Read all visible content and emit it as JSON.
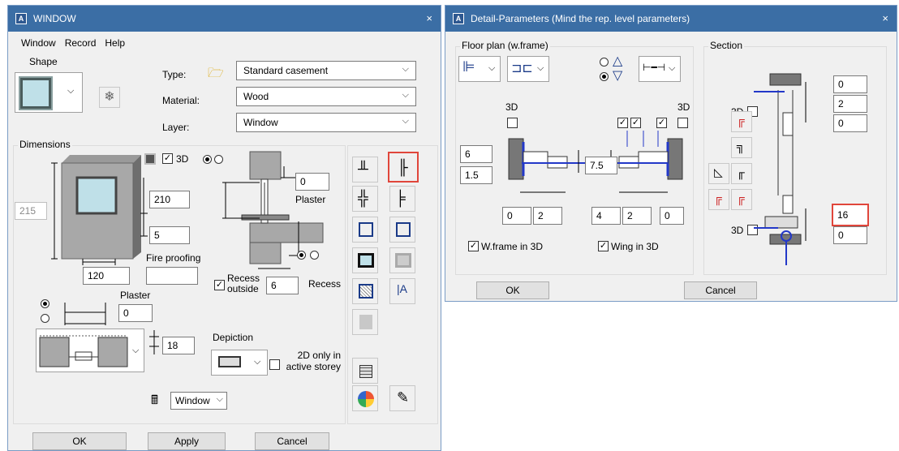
{
  "window1": {
    "title": "WINDOW",
    "close_glyph": "×",
    "menu": [
      "Window",
      "Record",
      "Help"
    ],
    "shape_label": "Shape",
    "type_label": "Type:",
    "type_value": "Standard casement",
    "material_label": "Material:",
    "material_value": "Wood",
    "layer_label": "Layer:",
    "layer_value": "Window",
    "dimensions_label": "Dimensions",
    "three_d_label": "3D",
    "height_value": "210",
    "sill_value": "5",
    "width_value": "120",
    "disabled_value": "215",
    "fire_proofing_label": "Fire proofing",
    "plaster_label_top": "Plaster",
    "plaster_value_top": "0",
    "recess_outside_label": "Recess outside",
    "recess_label": "Recess",
    "recess_value": "6",
    "plaster_label_bottom": "Plaster",
    "plaster_value_bottom": "0",
    "depiction_label": "Depiction",
    "depiction_value": "18",
    "only_2d_label": "2D only in active storey",
    "window_drop": "Window",
    "ok": "OK",
    "apply": "Apply",
    "cancel": "Cancel"
  },
  "window2": {
    "title": "Detail-Parameters (Mind the rep. level parameters)",
    "close_glyph": "×",
    "floor_plan_label": "Floor plan (w.frame)",
    "section_label": "Section",
    "three_d_left": "3D",
    "three_d_right": "3D",
    "val_6": "6",
    "val_1_5": "1.5",
    "val_7_5": "7.5",
    "val_0a": "0",
    "val_2a": "2",
    "val_4": "4",
    "val_2b": "2",
    "val_0b": "0",
    "wframe_3d": "W.frame in 3D",
    "wing_3d": "Wing in 3D",
    "section_3d_top": "3D",
    "section_3d_bottom": "3D",
    "sec_0a": "0",
    "sec_2": "2",
    "sec_0b": "0",
    "sec_16": "16",
    "sec_0c": "0",
    "ok": "OK",
    "cancel": "Cancel"
  }
}
